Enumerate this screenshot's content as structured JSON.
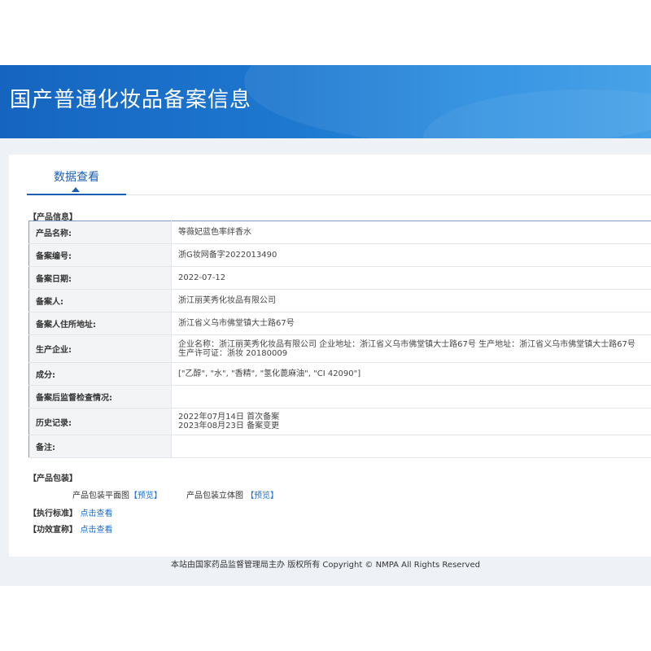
{
  "header": {
    "title": "国产普通化妆品备案信息"
  },
  "tabs": [
    {
      "label": "数据查看",
      "active": true
    }
  ],
  "product_info": {
    "section_title": "【产品信息】",
    "rows": [
      {
        "label": "产品名称:",
        "value": "等薇妃蓝色率绊香水"
      },
      {
        "label": "备案编号:",
        "value": "浙G妆网备字2022013490"
      },
      {
        "label": "备案日期:",
        "value": "2022-07-12"
      },
      {
        "label": "备案人:",
        "value": "浙江丽芙秀化妆品有限公司"
      },
      {
        "label": "备案人住所地址:",
        "value": "浙江省义乌市佛堂镇大士路67号"
      },
      {
        "label": "生产企业:",
        "value": "企业名称：浙江丽芙秀化妆品有限公司 企业地址：浙江省义乌市佛堂镇大士路67号 生产地址：浙江省义乌市佛堂镇大士路67号 生产许可证：浙妆 20180009"
      },
      {
        "label": "成分:",
        "value": "[\"乙醇\", \"水\", \"香精\", \"氢化蓖麻油\", \"CI 42090\"]"
      },
      {
        "label": "备案后监督检查情况:",
        "value": ""
      },
      {
        "label": "历史记录:",
        "value": "2022年07月14日 首次备案\n2023年08月23日 备案变更"
      },
      {
        "label": "备注:",
        "value": ""
      }
    ]
  },
  "packaging": {
    "section_title": "【产品包装】",
    "flat_label": "产品包装平面图",
    "flat_link": "【预览】",
    "solid_label": "产品包装立体图",
    "solid_link": "【预览】"
  },
  "standard": {
    "label": "【执行标准】",
    "link": "点击查看"
  },
  "efficacy": {
    "label": "【功效宣称】",
    "link": "点击查看"
  },
  "footer": {
    "text": "本站由国家药品监督管理局主办 版权所有 Copyright © NMPA All Rights Reserved"
  },
  "colors": {
    "banner": "#1e78d0",
    "accent": "#1a5fb4",
    "link": "#1a6fd0",
    "table_border": "#7a9cc6"
  }
}
